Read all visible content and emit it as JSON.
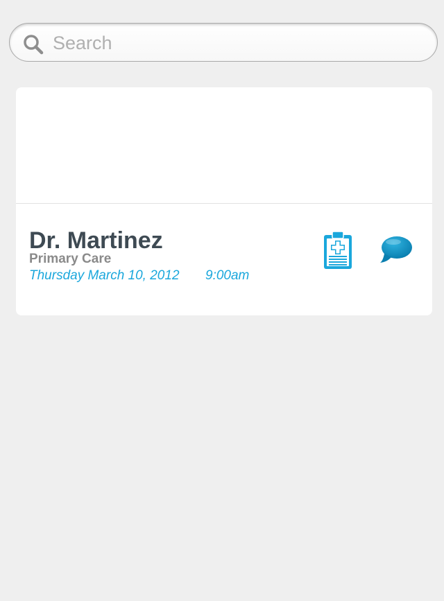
{
  "search": {
    "placeholder": "Search",
    "icon": "search-icon"
  },
  "appointment": {
    "doctor_name": "Dr. Martinez",
    "specialty": "Primary Care",
    "date": "Thursday March 10, 2012",
    "time": "9:00am",
    "actions": [
      {
        "icon": "medical-clipboard-icon"
      },
      {
        "icon": "chat-bubble-icon"
      }
    ]
  },
  "colors": {
    "background": "#efefef",
    "card": "#ffffff",
    "accent": "#1aa7dc",
    "name": "#3e4a53",
    "subtitle": "#8a8a8a"
  }
}
